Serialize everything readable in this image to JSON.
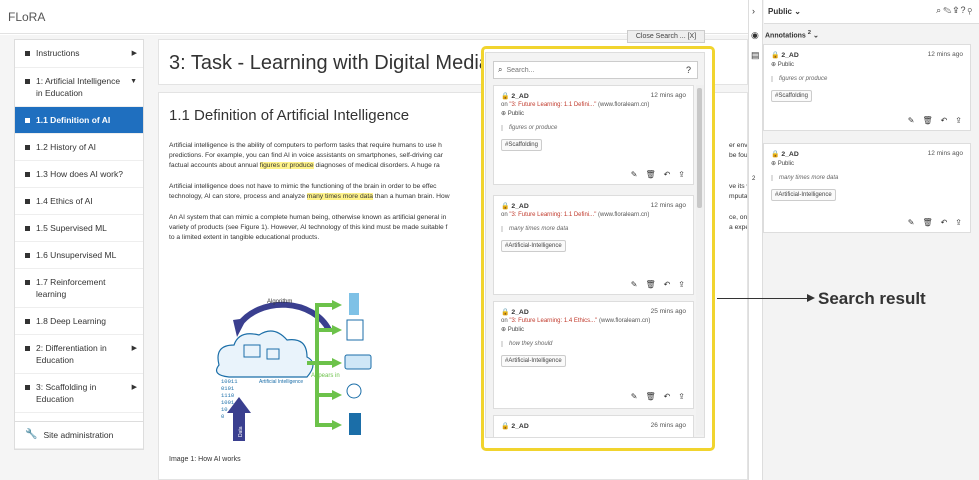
{
  "app": {
    "brand": "FLoRA"
  },
  "nav": {
    "items": [
      {
        "label": "Instructions",
        "caret": "▶",
        "active": false
      },
      {
        "label": "1: Artificial Intelligence in Education",
        "caret": "▼",
        "active": false
      },
      {
        "label": "1.1 Definition of AI",
        "caret": "",
        "active": true
      },
      {
        "label": "1.2 History of AI",
        "caret": "",
        "active": false
      },
      {
        "label": "1.3 How does AI work?",
        "caret": "",
        "active": false
      },
      {
        "label": "1.4 Ethics of AI",
        "caret": "",
        "active": false
      },
      {
        "label": "1.5 Supervised ML",
        "caret": "",
        "active": false
      },
      {
        "label": "1.6 Unsupervised ML",
        "caret": "",
        "active": false
      },
      {
        "label": "1.7 Reinforcement learning",
        "caret": "",
        "active": false
      },
      {
        "label": "1.8 Deep Learning",
        "caret": "",
        "active": false
      },
      {
        "label": "2: Differentiation in Education",
        "caret": "▶",
        "active": false
      },
      {
        "label": "3: Scaffolding in Education",
        "caret": "▶",
        "active": false
      }
    ],
    "admin": "Site administration"
  },
  "page": {
    "task_title": "3: Task - Learning with Digital Media",
    "section_title": "1.1 Definition of Artificial Intelligence",
    "p1_l1": "Artificial intelligence is the ability of computers to perform tasks that require humans to use h",
    "p1_l1_tail": "er environment,",
    "p1_l2": "predictions. For example, you can find AI in voice assistants on smartphones, self-driving car",
    "p1_l2_tail": "be found",
    "p1_l3_pre": "factual accounts about annual ",
    "p1_l3_hl": "figures or produce",
    "p1_l3_post": " diagnoses of medical disorders. A huge ra",
    "p2_l1": "Artificial intelligence does not have to mimic the functioning of the brain in order to be effec",
    "p2_l1_tail": "ve its wing",
    "p2_l2_pre": "technology, AI can store, process and analyze ",
    "p2_l2_hl": "many times more data",
    "p2_l2_post": " than a human brain. How",
    "p2_l2_tail": "mputation",
    "p3_l1": "An AI system that can mimic a complete human being, otherwise known as artificial general in",
    "p3_l1_tail": "ce, on the",
    "p3_l2": "variety of products (see Figure 1). However, AI technology of this kind must be made suitable f",
    "p3_l2_tail": "a expectatio",
    "p3_l3": "to a limited extent in tangible educational products.",
    "caption": "Image 1: How AI works",
    "fig_algorithm": "Algorithm",
    "fig_ai": "Artificial Intelligence",
    "fig_appears": "Appears in",
    "fig_data": "Data",
    "fig_binary": [
      "10011",
      "0101",
      "1110",
      "1001",
      "10",
      "0"
    ]
  },
  "search": {
    "close_label": "Close Search ... [X]",
    "placeholder": "Search...",
    "help": "?",
    "results": [
      {
        "user": "2_AD",
        "time": "12 mins ago",
        "on_prefix": "on ",
        "doc": "\"3: Future Learning: 1.1 Defini...\"",
        "site": " (www.floralearn.cn)",
        "visibility": "Public",
        "quote": "figures or produce",
        "tag": "#Scaffolding"
      },
      {
        "user": "2_AD",
        "time": "12 mins ago",
        "on_prefix": "on ",
        "doc": "\"3: Future Learning: 1.1 Defini...\"",
        "site": " (www.floralearn.cn)",
        "visibility": "Public",
        "quote": "many times more data",
        "tag": "#Artificial-Intelligence"
      },
      {
        "user": "2_AD",
        "time": "25 mins ago",
        "on_prefix": "on ",
        "doc": "\"3: Future Learning: 1.4 Ethics...\"",
        "site": " (www.floralearn.cn)",
        "visibility": "Public",
        "quote": "how they should",
        "tag": "#Artificial-Intelligence"
      },
      {
        "user": "2_AD",
        "time": "26 mins ago"
      }
    ]
  },
  "sidebar": {
    "group": "Public",
    "annotations_label": "Annotations",
    "annotations_count": "2",
    "cards": [
      {
        "user": "2_AD",
        "time": "12 mins ago",
        "visibility": "Public",
        "quote": "figures or produce",
        "tag": "#Scaffolding"
      },
      {
        "user": "2_AD",
        "time": "12 mins ago",
        "visibility": "Public",
        "quote": "many times more data",
        "tag": "#Artificial-Intelligence"
      }
    ],
    "badge": "2"
  },
  "annotation": {
    "label": "Search result"
  },
  "colors": {
    "active_nav": "#1f6fbf",
    "highlight": "#fff38a",
    "frame": "#f1d42e",
    "link": "#c0392b"
  },
  "icons": [
    "search-icon",
    "help-icon",
    "edit-icon",
    "delete-icon",
    "reply-icon",
    "share-icon",
    "eye-icon",
    "comment-icon",
    "wrench-icon",
    "lock-icon",
    "globe-icon"
  ]
}
